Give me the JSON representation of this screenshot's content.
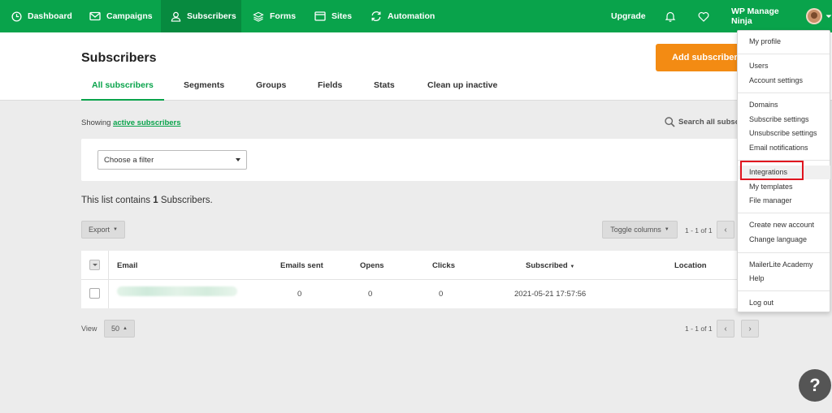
{
  "nav": {
    "items": [
      {
        "label": "Dashboard",
        "icon": "clock-icon"
      },
      {
        "label": "Campaigns",
        "icon": "envelope-icon"
      },
      {
        "label": "Subscribers",
        "icon": "user-icon"
      },
      {
        "label": "Forms",
        "icon": "layers-icon"
      },
      {
        "label": "Sites",
        "icon": "browser-icon"
      },
      {
        "label": "Automation",
        "icon": "refresh-icon"
      }
    ],
    "upgrade": "Upgrade",
    "account_name": "WP Manage Ninja"
  },
  "header": {
    "title": "Subscribers",
    "add_button": "Add subscribers",
    "tabs": [
      "All subscribers",
      "Segments",
      "Groups",
      "Fields",
      "Stats",
      "Clean up inactive"
    ]
  },
  "content": {
    "showing_prefix": "Showing",
    "showing_link": "active subscribers",
    "search_label": "Search all subsc",
    "filter_placeholder": "Choose a filter",
    "list_count_prefix": "This list contains",
    "list_count_number": "1",
    "list_count_suffix": "Subscribers.",
    "export_label": "Export",
    "toggle_columns_label": "Toggle columns",
    "pager_top": "1 - 1 of 1",
    "pager_bottom": "1 - 1 of 1",
    "view_label": "View",
    "view_value": "50"
  },
  "table": {
    "columns": [
      "Email",
      "Emails sent",
      "Opens",
      "Clicks",
      "Subscribed",
      "Location"
    ],
    "rows": [
      {
        "emails_sent": "0",
        "opens": "0",
        "clicks": "0",
        "subscribed": "2021-05-21 17:57:56"
      }
    ]
  },
  "account_menu": {
    "items": [
      "My profile",
      "Users",
      "Account settings",
      "Domains",
      "Subscribe settings",
      "Unsubscribe settings",
      "Email notifications",
      "Integrations",
      "My templates",
      "File manager",
      "Create new account",
      "Change language",
      "MailerLite Academy",
      "Help",
      "Log out"
    ],
    "highlighted": "Integrations",
    "highlight_color": "#e0141e"
  },
  "colors": {
    "brand_green": "#09a34b",
    "accent_orange": "#f38b13"
  }
}
